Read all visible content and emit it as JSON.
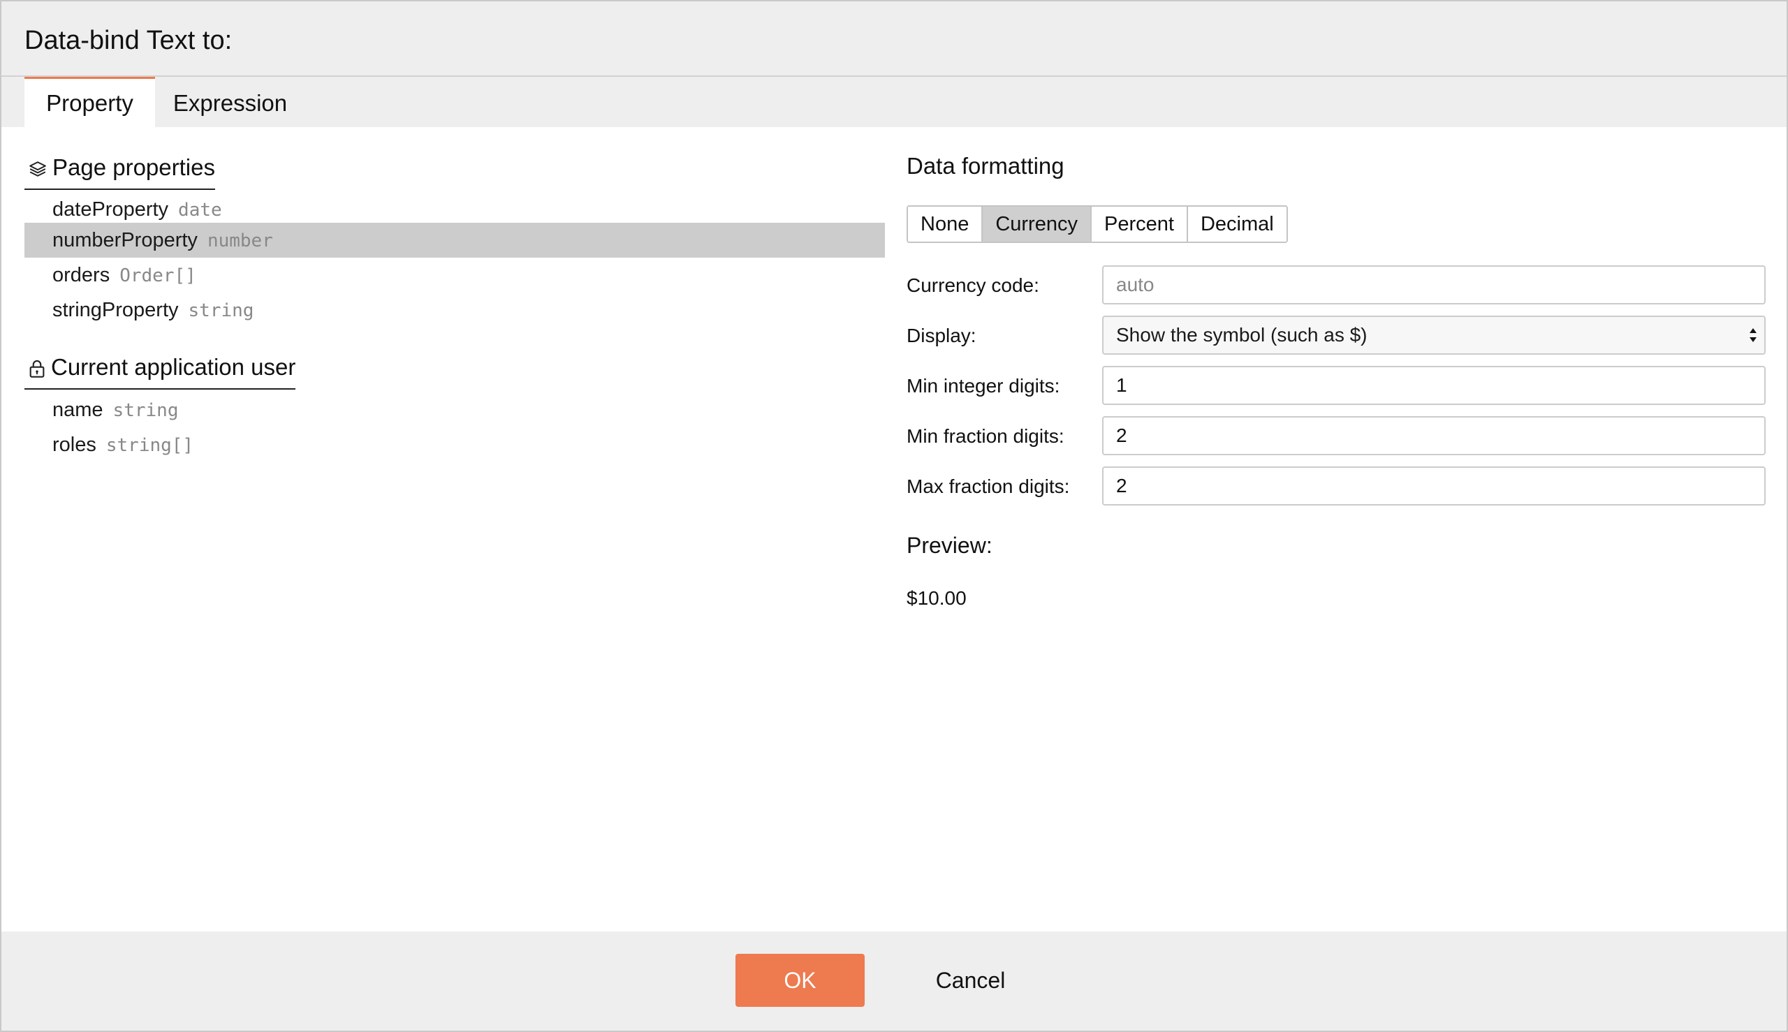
{
  "dialog": {
    "title": "Data-bind Text to:"
  },
  "tabs": [
    {
      "label": "Property",
      "active": true
    },
    {
      "label": "Expression",
      "active": false
    }
  ],
  "groups": {
    "page": {
      "title": "Page properties",
      "icon": "layers-icon",
      "items": [
        {
          "name": "dateProperty",
          "type": "date",
          "selected": false
        },
        {
          "name": "numberProperty",
          "type": "number",
          "selected": true
        },
        {
          "name": "orders",
          "type": "Order[]",
          "selected": false
        },
        {
          "name": "stringProperty",
          "type": "string",
          "selected": false
        }
      ]
    },
    "user": {
      "title": "Current application user",
      "icon": "lock-icon",
      "items": [
        {
          "name": "name",
          "type": "string"
        },
        {
          "name": "roles",
          "type": "string[]"
        }
      ]
    }
  },
  "formatting": {
    "title": "Data formatting",
    "options": [
      "None",
      "Currency",
      "Percent",
      "Decimal"
    ],
    "selected": "Currency",
    "currency_code": {
      "label": "Currency code:",
      "value": "",
      "placeholder": "auto"
    },
    "display": {
      "label": "Display:",
      "value": "Show the symbol (such as $)"
    },
    "min_integer": {
      "label": "Min integer digits:",
      "value": "1"
    },
    "min_fraction": {
      "label": "Min fraction digits:",
      "value": "2"
    },
    "max_fraction": {
      "label": "Max fraction digits:",
      "value": "2"
    },
    "preview_label": "Preview:",
    "preview_value": "$10.00"
  },
  "footer": {
    "ok_label": "OK",
    "cancel_label": "Cancel"
  },
  "colors": {
    "accent": "#ee7a4f",
    "selected_row": "#cccccc",
    "chrome": "#eeeeee"
  }
}
